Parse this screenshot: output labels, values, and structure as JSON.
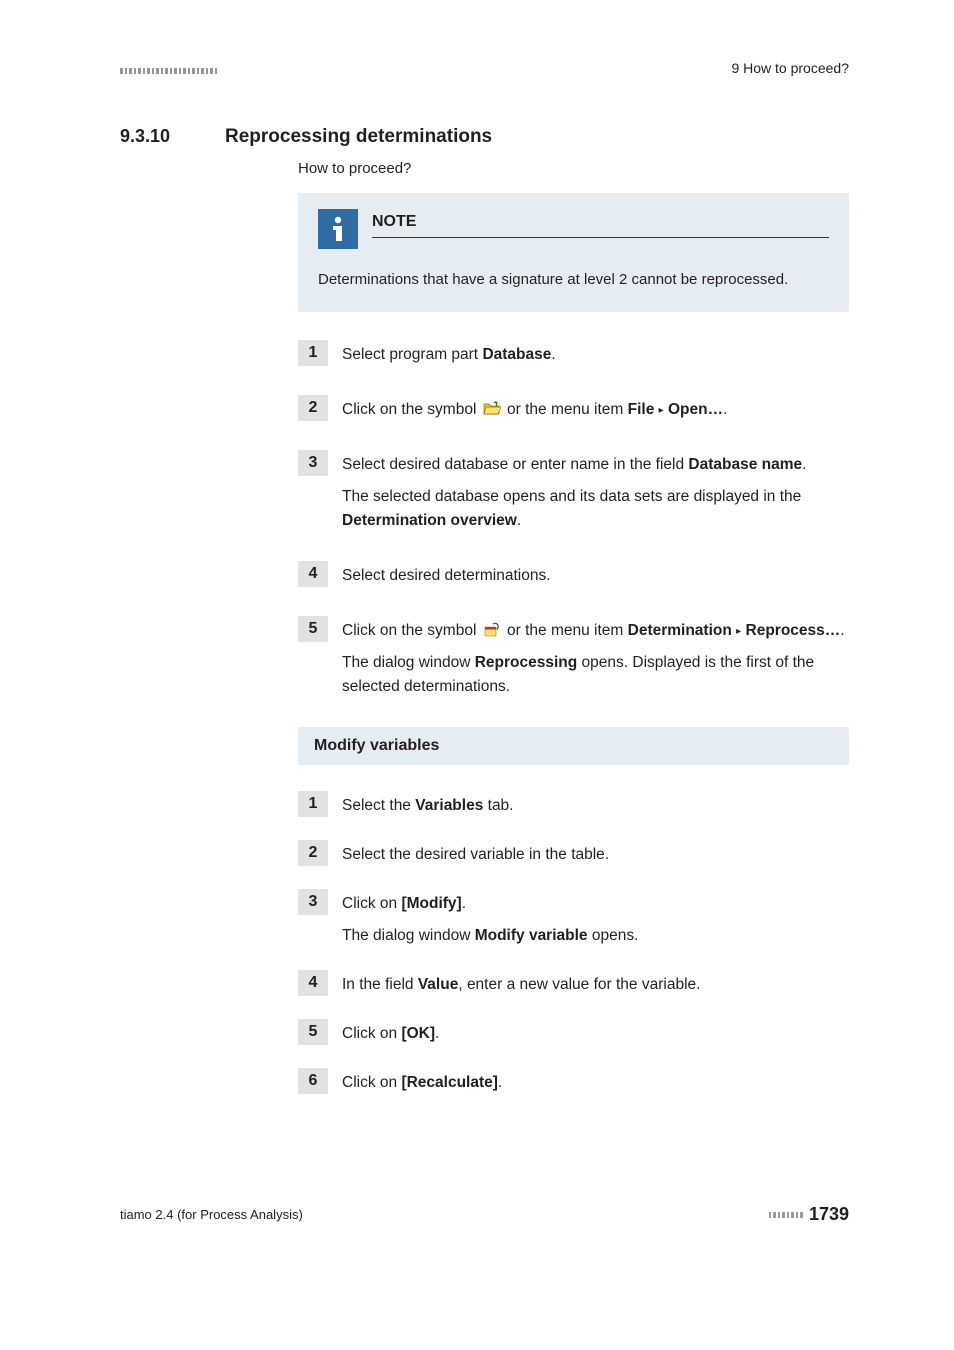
{
  "header": {
    "right": "9 How to proceed?"
  },
  "section": {
    "number": "9.3.10",
    "title": "Reprocessing determinations",
    "subtitle": "How to proceed?"
  },
  "note": {
    "label": "NOTE",
    "body": "Determinations that have a signature at level 2 cannot be reprocessed."
  },
  "steps": {
    "s1": {
      "n": "1",
      "a": "Select program part ",
      "b": "Database",
      "c": "."
    },
    "s2": {
      "n": "2",
      "a": "Click on the symbol ",
      "b": " or the menu item ",
      "c": "File",
      "d": "Open…",
      "e": "."
    },
    "s3": {
      "n": "3",
      "a": "Select desired database or enter name in the field ",
      "b": "Database name",
      "c": ".",
      "d": "The selected database opens and its data sets are displayed in the ",
      "e": "Determination overview",
      "f": "."
    },
    "s4": {
      "n": "4",
      "a": "Select desired determinations."
    },
    "s5": {
      "n": "5",
      "a": "Click on the symbol ",
      "b": " or the menu item ",
      "c": "Determination",
      "d": "Reprocess…",
      "e": ".",
      "f": "The dialog window ",
      "g": "Reprocessing",
      "h": " opens. Displayed is the first of the selected determinations."
    }
  },
  "subheading": "Modify variables",
  "steps2": {
    "s1": {
      "n": "1",
      "a": "Select the ",
      "b": "Variables",
      "c": " tab."
    },
    "s2": {
      "n": "2",
      "a": "Select the desired variable in the table."
    },
    "s3": {
      "n": "3",
      "a": "Click on ",
      "b": "[Modify]",
      "c": ".",
      "d": "The dialog window ",
      "e": "Modify variable",
      "f": " opens."
    },
    "s4": {
      "n": "4",
      "a": "In the field ",
      "b": "Value",
      "c": ", enter a new value for the variable."
    },
    "s5": {
      "n": "5",
      "a": "Click on ",
      "b": "[OK]",
      "c": "."
    },
    "s6": {
      "n": "6",
      "a": "Click on ",
      "b": "[Recalculate]",
      "c": "."
    }
  },
  "footer": {
    "left": "tiamo 2.4 (for Process Analysis)",
    "page": "1739"
  }
}
